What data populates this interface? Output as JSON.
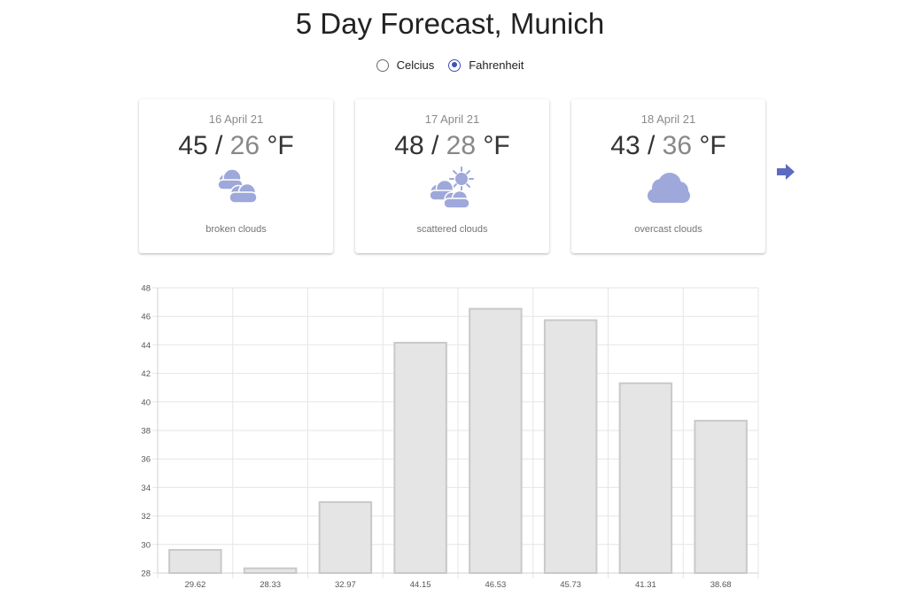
{
  "title": "5 Day Forecast, Munich",
  "units": {
    "options": [
      {
        "label": "Celcius",
        "checked": false
      },
      {
        "label": "Fahrenheit",
        "checked": true
      }
    ]
  },
  "cards": [
    {
      "date": "16 April 21",
      "high": "45",
      "low": "26",
      "unit": "°F",
      "description": "broken clouds",
      "icon": "broken-clouds-icon"
    },
    {
      "date": "17 April 21",
      "high": "48",
      "low": "28",
      "unit": "°F",
      "description": "scattered clouds",
      "icon": "scattered-clouds-icon"
    },
    {
      "date": "18 April 21",
      "high": "43",
      "low": "36",
      "unit": "°F",
      "description": "overcast clouds",
      "icon": "overcast-clouds-icon"
    }
  ],
  "separator": "/",
  "next_icon": "arrow-right-icon",
  "colors": {
    "accent": "#3f51b5",
    "icon": "#9fa8da",
    "bar_fill": "#e5e5e5",
    "bar_border": "#c9c9c9"
  },
  "chart_data": {
    "type": "bar",
    "categories": [
      "29.62",
      "28.33",
      "32.97",
      "44.15",
      "46.53",
      "45.73",
      "41.31",
      "38.68"
    ],
    "values": [
      29.62,
      28.33,
      32.97,
      44.15,
      46.53,
      45.73,
      41.31,
      38.68
    ],
    "yticks": [
      "28",
      "30",
      "32",
      "34",
      "36",
      "38",
      "40",
      "42",
      "44",
      "46",
      "48"
    ],
    "ylim": [
      28,
      48
    ],
    "grid": true
  }
}
